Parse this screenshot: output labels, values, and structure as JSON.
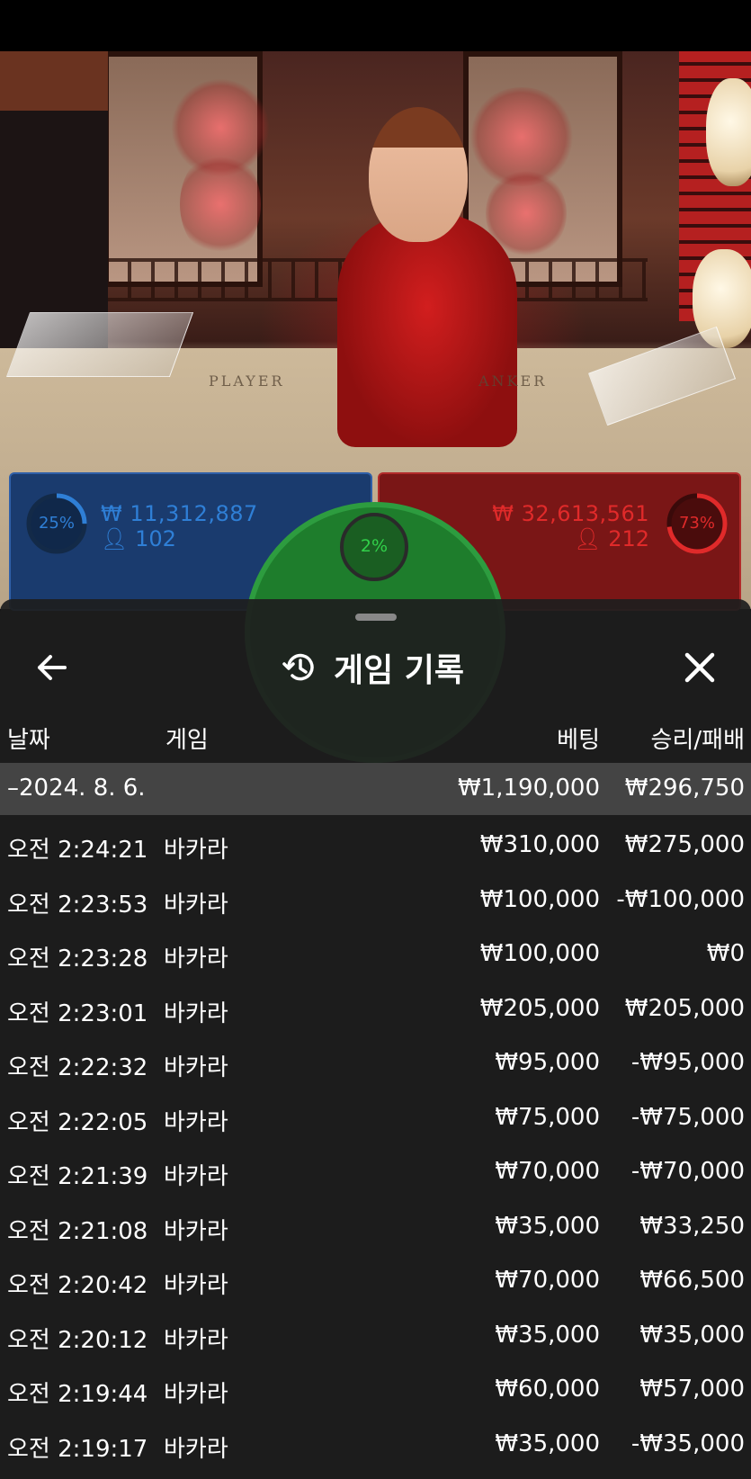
{
  "video": {
    "table_labels": {
      "player": "PLAYER",
      "banker": "ANKER"
    }
  },
  "bets": {
    "player": {
      "percent": "25%",
      "amount": "₩ 11,312,887",
      "count": "102",
      "color": "#2f7fd6"
    },
    "tie": {
      "percent": "2%",
      "color": "#31d04a"
    },
    "banker": {
      "percent": "73%",
      "amount": "₩ 32,613,561",
      "count": "212",
      "color": "#e02a2a"
    }
  },
  "sheet": {
    "title": "게임 기록",
    "icons": {
      "back": "arrow-left-icon",
      "history": "history-icon",
      "close": "close-icon"
    },
    "columns": {
      "date": "날짜",
      "game": "게임",
      "bet": "베팅",
      "result": "승리/패배"
    },
    "summary": {
      "date": "–2024. 8. 6.",
      "bet": "₩1,190,000",
      "result": "₩296,750"
    },
    "rows": [
      {
        "time": "오전 2:24:21",
        "game": "바카라",
        "bet": "₩310,000",
        "result": "₩275,000"
      },
      {
        "time": "오전 2:23:53",
        "game": "바카라",
        "bet": "₩100,000",
        "result": "-₩100,000"
      },
      {
        "time": "오전 2:23:28",
        "game": "바카라",
        "bet": "₩100,000",
        "result": "₩0"
      },
      {
        "time": "오전 2:23:01",
        "game": "바카라",
        "bet": "₩205,000",
        "result": "₩205,000"
      },
      {
        "time": "오전 2:22:32",
        "game": "바카라",
        "bet": "₩95,000",
        "result": "-₩95,000"
      },
      {
        "time": "오전 2:22:05",
        "game": "바카라",
        "bet": "₩75,000",
        "result": "-₩75,000"
      },
      {
        "time": "오전 2:21:39",
        "game": "바카라",
        "bet": "₩70,000",
        "result": "-₩70,000"
      },
      {
        "time": "오전 2:21:08",
        "game": "바카라",
        "bet": "₩35,000",
        "result": "₩33,250"
      },
      {
        "time": "오전 2:20:42",
        "game": "바카라",
        "bet": "₩70,000",
        "result": "₩66,500"
      },
      {
        "time": "오전 2:20:12",
        "game": "바카라",
        "bet": "₩35,000",
        "result": "₩35,000"
      },
      {
        "time": "오전 2:19:44",
        "game": "바카라",
        "bet": "₩60,000",
        "result": "₩57,000"
      },
      {
        "time": "오전 2:19:17",
        "game": "바카라",
        "bet": "₩35,000",
        "result": "-₩35,000"
      }
    ]
  }
}
